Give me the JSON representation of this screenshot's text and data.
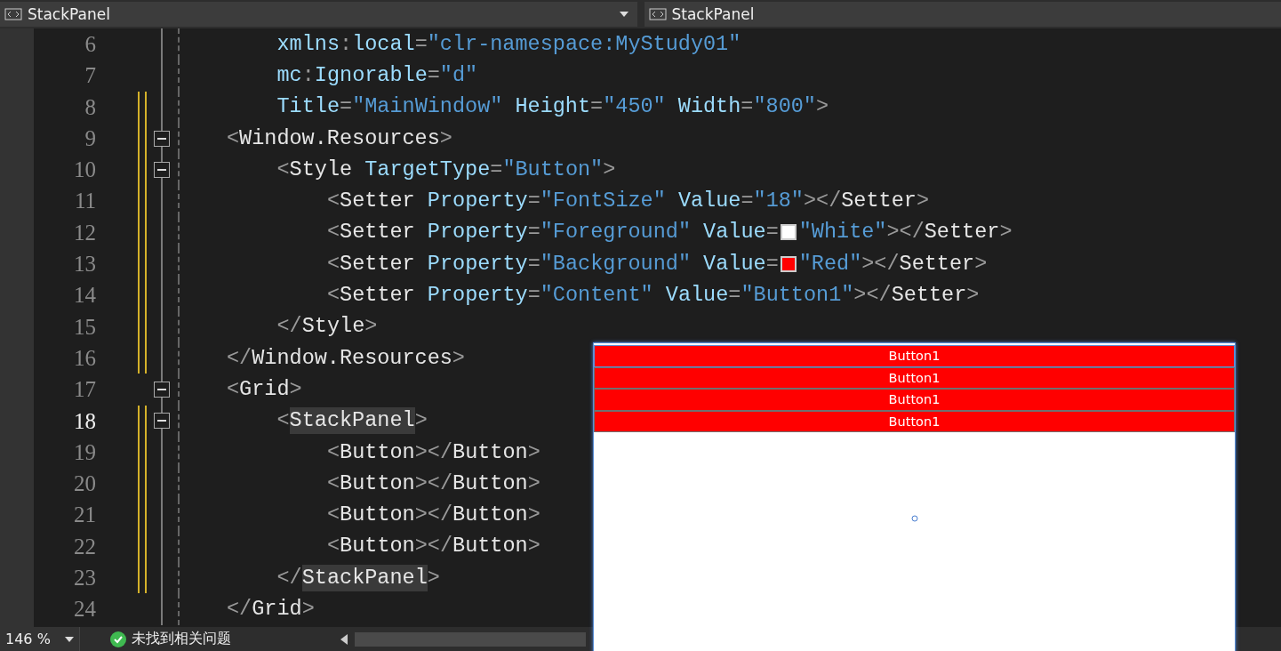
{
  "nav_bar": [
    {
      "label": "StackPanel",
      "dropdown": true
    },
    {
      "label": "StackPanel",
      "dropdown": false
    }
  ],
  "editor": {
    "lines": [
      {
        "number": "6",
        "kind": "continuation",
        "changed": false,
        "current": false,
        "tokens": [
          {
            "kind": "attr",
            "text": "xmlns"
          },
          {
            "kind": "punct",
            "text": ":"
          },
          {
            "kind": "attr",
            "text": "local"
          },
          {
            "kind": "punct",
            "text": "="
          },
          {
            "kind": "value",
            "text": "\"clr-namespace:MyStudy01\""
          }
        ]
      },
      {
        "number": "7",
        "kind": "continuation",
        "changed": false,
        "current": false,
        "tokens": [
          {
            "kind": "attr",
            "text": "mc"
          },
          {
            "kind": "punct",
            "text": ":"
          },
          {
            "kind": "attr",
            "text": "Ignorable"
          },
          {
            "kind": "punct",
            "text": "="
          },
          {
            "kind": "value",
            "text": "\"d\""
          }
        ]
      },
      {
        "number": "8",
        "kind": "continuation",
        "changed": true,
        "current": false,
        "tokens": [
          {
            "kind": "attr",
            "text": "Title"
          },
          {
            "kind": "punct",
            "text": "="
          },
          {
            "kind": "value",
            "text": "\"MainWindow\""
          },
          {
            "kind": "attr",
            "text": " Height"
          },
          {
            "kind": "punct",
            "text": "="
          },
          {
            "kind": "value",
            "text": "\"450\""
          },
          {
            "kind": "attr",
            "text": " Width"
          },
          {
            "kind": "punct",
            "text": "="
          },
          {
            "kind": "value",
            "text": "\"800\""
          },
          {
            "kind": "punct",
            "text": ">"
          }
        ]
      },
      {
        "number": "9",
        "kind": "element",
        "changed": true,
        "current": false,
        "expanded": true,
        "tokens": [
          {
            "kind": "punct",
            "text": "<"
          },
          {
            "kind": "name",
            "text": "Window.Resources"
          },
          {
            "kind": "punct",
            "text": ">"
          }
        ],
        "children": [
          {
            "number": "10",
            "kind": "element",
            "changed": true,
            "current": false,
            "expanded": true,
            "tokens": [
              {
                "kind": "punct",
                "text": "<"
              },
              {
                "kind": "name",
                "text": "Style"
              },
              {
                "kind": "attr",
                "text": " TargetType"
              },
              {
                "kind": "punct",
                "text": "="
              },
              {
                "kind": "value",
                "text": "\"Button\""
              },
              {
                "kind": "punct",
                "text": ">"
              }
            ],
            "children": [
              {
                "number": "11",
                "kind": "element",
                "changed": true,
                "current": false,
                "tokens": [
                  {
                    "kind": "punct",
                    "text": "<"
                  },
                  {
                    "kind": "name",
                    "text": "Setter"
                  },
                  {
                    "kind": "attr",
                    "text": " Property"
                  },
                  {
                    "kind": "punct",
                    "text": "="
                  },
                  {
                    "kind": "value",
                    "text": "\"FontSize\""
                  },
                  {
                    "kind": "attr",
                    "text": " Value"
                  },
                  {
                    "kind": "punct",
                    "text": "="
                  },
                  {
                    "kind": "value",
                    "text": "\"18\""
                  },
                  {
                    "kind": "punct",
                    "text": "></"
                  },
                  {
                    "kind": "name",
                    "text": "Setter"
                  },
                  {
                    "kind": "punct",
                    "text": ">"
                  }
                ]
              },
              {
                "number": "12",
                "kind": "element",
                "changed": true,
                "current": false,
                "tokens": [
                  {
                    "kind": "punct",
                    "text": "<"
                  },
                  {
                    "kind": "name",
                    "text": "Setter"
                  },
                  {
                    "kind": "attr",
                    "text": " Property"
                  },
                  {
                    "kind": "punct",
                    "text": "="
                  },
                  {
                    "kind": "value",
                    "text": "\"Foreground\""
                  },
                  {
                    "kind": "attr",
                    "text": " Value"
                  },
                  {
                    "kind": "punct",
                    "text": "="
                  },
                  {
                    "kind": "swatch",
                    "color": "#ffffff"
                  },
                  {
                    "kind": "value",
                    "text": "\"White\""
                  },
                  {
                    "kind": "punct",
                    "text": "></"
                  },
                  {
                    "kind": "name",
                    "text": "Setter"
                  },
                  {
                    "kind": "punct",
                    "text": ">"
                  }
                ]
              },
              {
                "number": "13",
                "kind": "element",
                "changed": true,
                "current": false,
                "tokens": [
                  {
                    "kind": "punct",
                    "text": "<"
                  },
                  {
                    "kind": "name",
                    "text": "Setter"
                  },
                  {
                    "kind": "attr",
                    "text": " Property"
                  },
                  {
                    "kind": "punct",
                    "text": "="
                  },
                  {
                    "kind": "value",
                    "text": "\"Background\""
                  },
                  {
                    "kind": "attr",
                    "text": " Value"
                  },
                  {
                    "kind": "punct",
                    "text": "="
                  },
                  {
                    "kind": "swatch",
                    "color": "#ff0000"
                  },
                  {
                    "kind": "value",
                    "text": "\"Red\""
                  },
                  {
                    "kind": "punct",
                    "text": "></"
                  },
                  {
                    "kind": "name",
                    "text": "Setter"
                  },
                  {
                    "kind": "punct",
                    "text": ">"
                  }
                ]
              },
              {
                "number": "14",
                "kind": "element",
                "changed": true,
                "current": false,
                "tokens": [
                  {
                    "kind": "punct",
                    "text": "<"
                  },
                  {
                    "kind": "name",
                    "text": "Setter"
                  },
                  {
                    "kind": "attr",
                    "text": " Property"
                  },
                  {
                    "kind": "punct",
                    "text": "="
                  },
                  {
                    "kind": "value",
                    "text": "\"Content\""
                  },
                  {
                    "kind": "attr",
                    "text": " Value"
                  },
                  {
                    "kind": "punct",
                    "text": "="
                  },
                  {
                    "kind": "value",
                    "text": "\"Button1\""
                  },
                  {
                    "kind": "punct",
                    "text": "></"
                  },
                  {
                    "kind": "name",
                    "text": "Setter"
                  },
                  {
                    "kind": "punct",
                    "text": ">"
                  }
                ]
              }
            ]
          },
          {
            "number": "15",
            "kind": "element",
            "changed": true,
            "current": false,
            "tokens": [
              {
                "kind": "punct",
                "text": "</"
              },
              {
                "kind": "name",
                "text": "Style"
              },
              {
                "kind": "punct",
                "text": ">"
              }
            ]
          }
        ]
      },
      {
        "number": "16",
        "kind": "element",
        "changed": true,
        "current": false,
        "tokens": [
          {
            "kind": "punct",
            "text": "</"
          },
          {
            "kind": "name",
            "text": "Window.Resources"
          },
          {
            "kind": "punct",
            "text": ">"
          }
        ]
      },
      {
        "number": "17",
        "kind": "element",
        "changed": false,
        "current": false,
        "expanded": true,
        "tokens": [
          {
            "kind": "punct",
            "text": "<"
          },
          {
            "kind": "name",
            "text": "Grid"
          },
          {
            "kind": "punct",
            "text": ">"
          }
        ],
        "children": [
          {
            "number": "18",
            "kind": "element",
            "changed": true,
            "current": true,
            "expanded": true,
            "tokens": [
              {
                "kind": "punct",
                "text": "<"
              },
              {
                "kind": "match",
                "text": "StackPanel"
              },
              {
                "kind": "punct",
                "text": ">"
              }
            ],
            "children": [
              {
                "number": "19",
                "kind": "element",
                "changed": true,
                "current": false,
                "tokens": [
                  {
                    "kind": "punct",
                    "text": "<"
                  },
                  {
                    "kind": "name",
                    "text": "Button"
                  },
                  {
                    "kind": "punct",
                    "text": "></"
                  },
                  {
                    "kind": "name",
                    "text": "Button"
                  },
                  {
                    "kind": "punct",
                    "text": ">"
                  }
                ]
              },
              {
                "number": "20",
                "kind": "element",
                "changed": true,
                "current": false,
                "tokens": [
                  {
                    "kind": "punct",
                    "text": "<"
                  },
                  {
                    "kind": "name",
                    "text": "Button"
                  },
                  {
                    "kind": "punct",
                    "text": "></"
                  },
                  {
                    "kind": "name",
                    "text": "Button"
                  },
                  {
                    "kind": "punct",
                    "text": ">"
                  }
                ]
              },
              {
                "number": "21",
                "kind": "element",
                "changed": true,
                "current": false,
                "tokens": [
                  {
                    "kind": "punct",
                    "text": "<"
                  },
                  {
                    "kind": "name",
                    "text": "Button"
                  },
                  {
                    "kind": "punct",
                    "text": "></"
                  },
                  {
                    "kind": "name",
                    "text": "Button"
                  },
                  {
                    "kind": "punct",
                    "text": ">"
                  }
                ]
              },
              {
                "number": "22",
                "kind": "element",
                "changed": true,
                "current": false,
                "tokens": [
                  {
                    "kind": "punct",
                    "text": "<"
                  },
                  {
                    "kind": "name",
                    "text": "Button"
                  },
                  {
                    "kind": "punct",
                    "text": "></"
                  },
                  {
                    "kind": "name",
                    "text": "Button"
                  },
                  {
                    "kind": "punct",
                    "text": ">"
                  }
                ]
              }
            ]
          },
          {
            "number": "23",
            "kind": "element",
            "changed": true,
            "current": false,
            "tokens": [
              {
                "kind": "punct",
                "text": "</"
              },
              {
                "kind": "match",
                "text": "StackPanel"
              },
              {
                "kind": "punct",
                "text": ">"
              }
            ]
          }
        ]
      },
      {
        "number": "24",
        "kind": "element",
        "changed": false,
        "current": false,
        "tokens": [
          {
            "kind": "punct",
            "text": "</"
          },
          {
            "kind": "name",
            "text": "Grid"
          },
          {
            "kind": "punct",
            "text": ">"
          }
        ]
      }
    ]
  },
  "preview": {
    "buttons": [
      {
        "label": "Button1",
        "selected": true
      },
      {
        "label": "Button1",
        "selected": false
      },
      {
        "label": "Button1",
        "selected": false
      },
      {
        "label": "Button1",
        "selected": false
      }
    ]
  },
  "status_bar": {
    "zoom": "146 %",
    "issues": "未找到相关问题"
  }
}
